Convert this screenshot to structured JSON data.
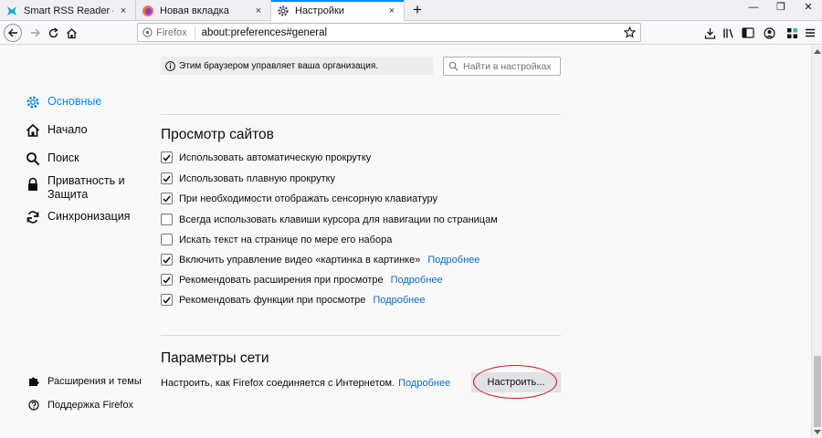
{
  "tabs": [
    {
      "title": "Smart RSS Reader – Загрузите",
      "close": "×"
    },
    {
      "title": "Новая вкладка",
      "close": "×"
    },
    {
      "title": "Настройки",
      "close": "×"
    }
  ],
  "new_tab": "+",
  "window_controls": {
    "minimize": "—",
    "restore": "❐",
    "close": "✕"
  },
  "url": {
    "identity": "Firefox",
    "address": "about:preferences#general"
  },
  "sidebar": {
    "categories": [
      {
        "label": "Основные",
        "icon": "gear-icon",
        "selected": true
      },
      {
        "label": "Начало",
        "icon": "home-icon"
      },
      {
        "label": "Поиск",
        "icon": "search-icon"
      },
      {
        "label": "Приватность и\nЗащита",
        "icon": "lock-icon"
      },
      {
        "label": "Синхронизация",
        "icon": "sync-icon"
      }
    ],
    "footer": [
      {
        "label": "Расширения и темы",
        "icon": "puzzle-icon"
      },
      {
        "label": "Поддержка Firefox",
        "icon": "help-icon"
      }
    ]
  },
  "policy_notice": "Этим браузером управляет ваша организация.",
  "search": {
    "placeholder": "Найти в настройках"
  },
  "browsing": {
    "title": "Просмотр сайтов",
    "options": [
      {
        "label": "Использовать автоматическую прокрутку",
        "checked": true
      },
      {
        "label": "Использовать плавную прокрутку",
        "checked": true
      },
      {
        "label": "При необходимости отображать сенсорную клавиатуру",
        "checked": true
      },
      {
        "label": "Всегда использовать клавиши курсора для навигации по страницам",
        "checked": false
      },
      {
        "label": "Искать текст на странице по мере его набора",
        "checked": false
      },
      {
        "label": "Включить управление видео «картинка в картинке»",
        "checked": true,
        "link": "Подробнее"
      },
      {
        "label": "Рекомендовать расширения при просмотре",
        "checked": true,
        "link": "Подробнее"
      },
      {
        "label": "Рекомендовать функции при просмотре",
        "checked": true,
        "link": "Подробнее"
      }
    ]
  },
  "network": {
    "title": "Параметры сети",
    "description": "Настроить, как Firefox соединяется с Интернетом.",
    "link": "Подробнее",
    "button": "Настроить..."
  },
  "colors": {
    "accent": "#0a84ff",
    "link": "#0a6ac8",
    "highlight": "#d0151c"
  }
}
